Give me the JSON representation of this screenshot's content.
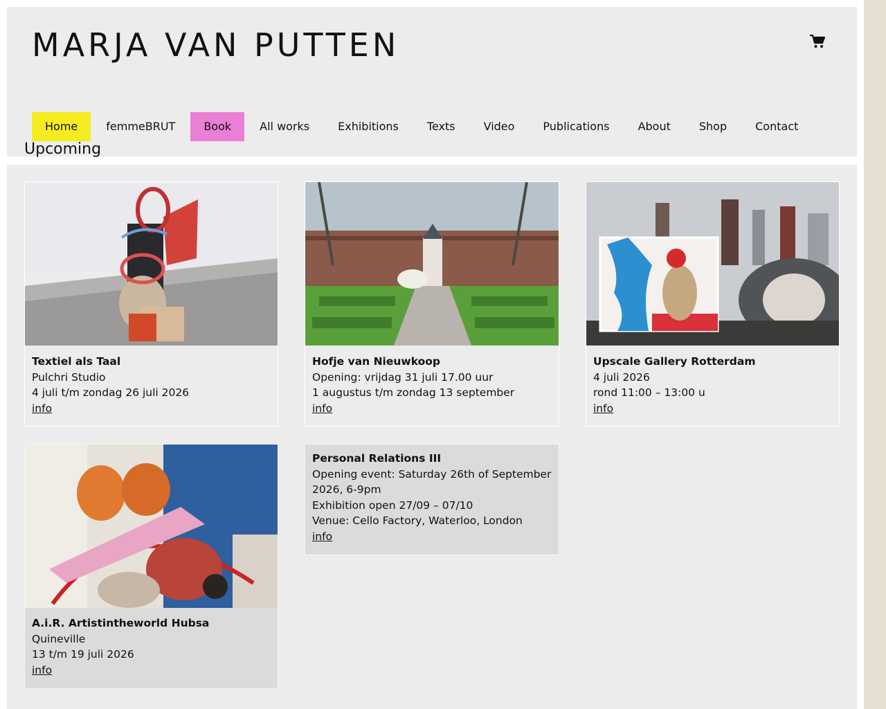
{
  "site": {
    "title": "MARJA VAN PUTTEN",
    "cart_icon": "shopping-cart-icon"
  },
  "nav": {
    "items": [
      {
        "label": "Home",
        "color": "#f5ec1f"
      },
      {
        "label": "femmeBRUT"
      },
      {
        "label": "Book",
        "color": "#ea7fd6"
      },
      {
        "label": "All works"
      },
      {
        "label": "Exhibitions"
      },
      {
        "label": "Texts"
      },
      {
        "label": "Video"
      },
      {
        "label": "Publications"
      },
      {
        "label": "About"
      },
      {
        "label": "Shop"
      },
      {
        "label": "Contact"
      }
    ]
  },
  "upcoming": {
    "heading": "Upcoming",
    "cards": [
      {
        "title": "Textiel als Taal",
        "lines": [
          "Pulchri Studio",
          "4 juli t/m zondag 26 juli 2026"
        ],
        "link": "info",
        "image": "textile-sculpture-photo"
      },
      {
        "title": "Hofje van Nieuwkoop",
        "lines": [
          "Opening: vrijdag 31 juli 17.00 uur",
          "1 augustus t/m zondag 13 september"
        ],
        "link": "info",
        "image": "courtyard-garden-photo"
      },
      {
        "title": "Upscale Gallery Rotterdam",
        "lines": [
          "4 juli 2026",
          "rond 11:00 – 13:00 u"
        ],
        "link": "info",
        "image": "rotterdam-skyline-artwork-photo"
      },
      {
        "title": "A.i.R. Artistintheworld Hubsa",
        "lines": [
          "Quineville",
          "13 t/m 19 juli 2026"
        ],
        "link": "info",
        "image": "textile-assemblage-photo"
      },
      {
        "title": "Personal Relations III",
        "lines": [
          "Opening event: Saturday 26th of September 2026, 6-9pm",
          "Exhibition open 27/09 – 07/10",
          "Venue: Cello Factory, Waterloo, London"
        ],
        "link": "info"
      }
    ]
  }
}
